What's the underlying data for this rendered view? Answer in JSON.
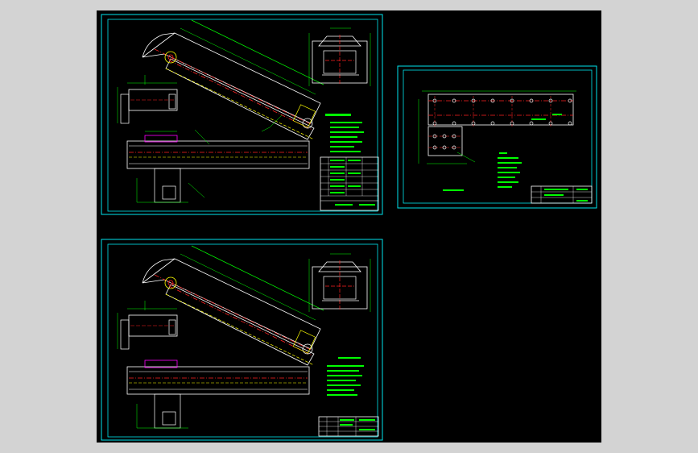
{
  "viewer": {
    "background_color": "#d3d3d3",
    "canvas_color": "#000000"
  },
  "colors": {
    "sheet_border": "#00e5ee",
    "geometry": "#ffffff",
    "green": "#00ff00",
    "center_line": "#ff2020",
    "yellow": "#ffff00",
    "magenta": "#ff00ff"
  },
  "sheets": [
    {
      "id": "sheet-top-left",
      "variant": "conveyor-with-table"
    },
    {
      "id": "sheet-right",
      "variant": "frame-detail"
    },
    {
      "id": "sheet-bottom-left",
      "variant": "conveyor-title-block"
    }
  ]
}
